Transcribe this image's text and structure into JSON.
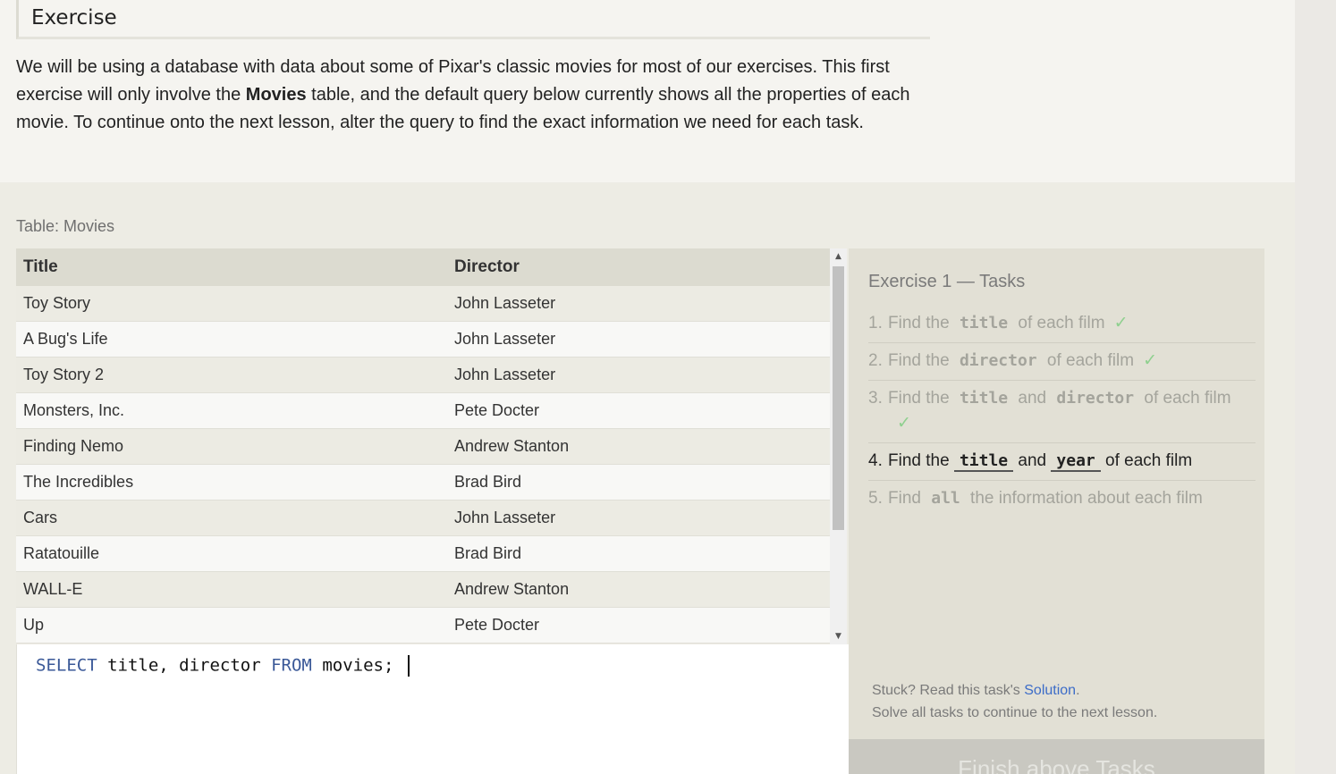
{
  "intro": {
    "heading": "Exercise",
    "text_1": "We will be using a database with data about some of Pixar's classic movies for most of our exercises. This first exercise will only involve the ",
    "text_bold": "Movies",
    "text_2": " table, and the default query below currently shows all the properties of each movie. To continue onto the next lesson, alter the query to find the exact information we need for each task."
  },
  "table": {
    "caption": "Table: Movies",
    "headers": [
      "Title",
      "Director"
    ],
    "rows": [
      [
        "Toy Story",
        "John Lasseter"
      ],
      [
        "A Bug's Life",
        "John Lasseter"
      ],
      [
        "Toy Story 2",
        "John Lasseter"
      ],
      [
        "Monsters, Inc.",
        "Pete Docter"
      ],
      [
        "Finding Nemo",
        "Andrew Stanton"
      ],
      [
        "The Incredibles",
        "Brad Bird"
      ],
      [
        "Cars",
        "John Lasseter"
      ],
      [
        "Ratatouille",
        "Brad Bird"
      ],
      [
        "WALL-E",
        "Andrew Stanton"
      ],
      [
        "Up",
        "Pete Docter"
      ]
    ]
  },
  "editor": {
    "kw_select": "SELECT",
    "cols": " title, director ",
    "kw_from": "FROM",
    "rest": " movies; "
  },
  "tasks": {
    "title": "Exercise 1 — Tasks",
    "check": "✓",
    "items": [
      {
        "num": "1.",
        "parts": [
          "Find the",
          "title",
          "of each film"
        ]
      },
      {
        "num": "2.",
        "parts": [
          "Find the",
          "director",
          "of each film"
        ]
      },
      {
        "num": "3.",
        "parts": [
          "Find the",
          "title",
          "and",
          "director",
          "of each film"
        ]
      },
      {
        "num": "4.",
        "parts": [
          "Find the",
          "title",
          "and",
          "year",
          "of each film"
        ]
      },
      {
        "num": "5.",
        "parts": [
          "Find",
          "all",
          "the information about each film"
        ]
      }
    ],
    "help_1": "Stuck? Read this task's ",
    "help_link": "Solution",
    "help_2": ".",
    "help_line2": "Solve all tasks to continue to the next lesson.",
    "finish_label": "Finish above Tasks"
  },
  "colors": {
    "keyword": "#3b5998",
    "check": "#8fd08f",
    "link": "#3c6cc8"
  }
}
